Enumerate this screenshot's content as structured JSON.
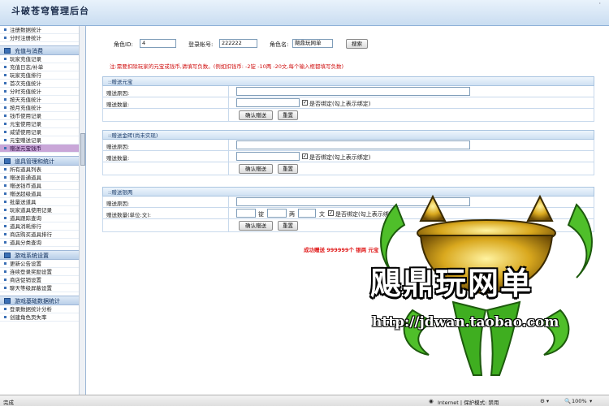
{
  "header": {
    "title": "斗破苍穹管理后台",
    "window_dots": "·"
  },
  "sidebar": {
    "top_items": [
      "注册数据统计",
      "分时注册统计"
    ],
    "groups": [
      {
        "title": "充值与消费",
        "items": [
          "玩家充值记录",
          "充值日志/补单",
          "玩家充值排行",
          "首次充值统计",
          "分时充值统计",
          "按天充值统计",
          "按月充值统计",
          "钱币使用记录",
          "元宝使用记录",
          "威望使用记录",
          "元宝赠送记录",
          "赠送元宝钱币"
        ],
        "active": 11
      },
      {
        "title": "道具管理和统计",
        "items": [
          "所有道具列表",
          "赠送普通道具",
          "赠送钱币道具",
          "赠送超级道具",
          "批量送道具",
          "玩家道具使用记录",
          "道具跟踪查询",
          "道具消耗排行",
          "商店购买道具排行",
          "道具分类查询"
        ]
      },
      {
        "title": "游戏系统设置",
        "items": [
          "更新公告设置",
          "连续登录奖励设置",
          "商店促销设置",
          "聊天等级屏蔽设置"
        ]
      },
      {
        "title": "游戏基础数据统计",
        "items": [
          "登录数据统计分析",
          "创建角色页失率"
        ]
      }
    ]
  },
  "search": {
    "role_id_label": "角色ID:",
    "role_id_value": "4",
    "account_label": "登录帐号:",
    "account_value": "222222",
    "role_name_label": "角色名:",
    "role_name_value": "飓鼎玩网单",
    "search_button": "搜索"
  },
  "note": "注:需要扣除玩家的元宝或钱币,请填写负数。(例如扣钱币: -2锭 -10两 -20文,每个输入框都填写负数)",
  "sections": {
    "yuanbao": {
      "title": "::赠送元宝",
      "reason_label": "赠送原因:",
      "amount_label": "赠送数量:",
      "bind_label": "是否绑定(勾上表示绑定)",
      "confirm_button": "确认赠送",
      "reset_button": "重置"
    },
    "gold": {
      "title": "::赠送金砖(尚未实现)",
      "reason_label": "赠送原因:",
      "amount_label": "赠送数量:",
      "bind_label": "是否绑定(勾上表示绑定)",
      "confirm_button": "确认赠送",
      "reset_button": "重置"
    },
    "silver": {
      "title": "::赠送银两",
      "reason_label": "赠送原因:",
      "amount_label": "赠送数量(单位:文):",
      "unit_ding": "锭",
      "unit_liang": "两",
      "unit_wen": "文",
      "bind_label": "是否绑定(勾上表示绑定)",
      "confirm_button": "确认赠送",
      "reset_button": "重置"
    }
  },
  "success_message": "成功赠送 999999个 银两 元宝",
  "watermark": {
    "text": "飓鼎玩网单",
    "url": "http://jdwan.taobao.com"
  },
  "statusbar": {
    "left": "完成",
    "zone": "Internet | 保护模式: 禁用",
    "zoom": "100%"
  },
  "colors": {
    "accent": "#3a6fb5",
    "active_item": "#c9a6d8",
    "alert_red": "#d01010"
  }
}
